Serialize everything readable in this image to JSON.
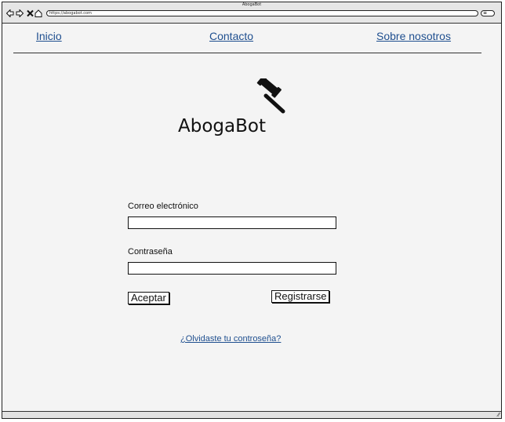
{
  "browser": {
    "title": "AbogaBot",
    "url": "https://abogabot.com",
    "icons": {
      "back": "back-arrow-icon",
      "forward": "forward-arrow-icon",
      "stop": "close-icon",
      "home": "home-icon",
      "menu": "menu-icon"
    }
  },
  "nav": {
    "inicio": "Inicio",
    "contacto": "Contacto",
    "sobre": "Sobre nosotros"
  },
  "brand": {
    "name": "AbogaBot",
    "logo_icon": "gavel-icon"
  },
  "form": {
    "email_label": "Correo electrónico",
    "email_value": "",
    "password_label": "Contraseña",
    "password_value": "",
    "accept_button": "Aceptar",
    "register_button": "Registrarse",
    "forgot_link": "¿Olvidaste tu controseña?"
  },
  "colors": {
    "link": "#1f4f8f",
    "background": "#f4f4f4"
  }
}
